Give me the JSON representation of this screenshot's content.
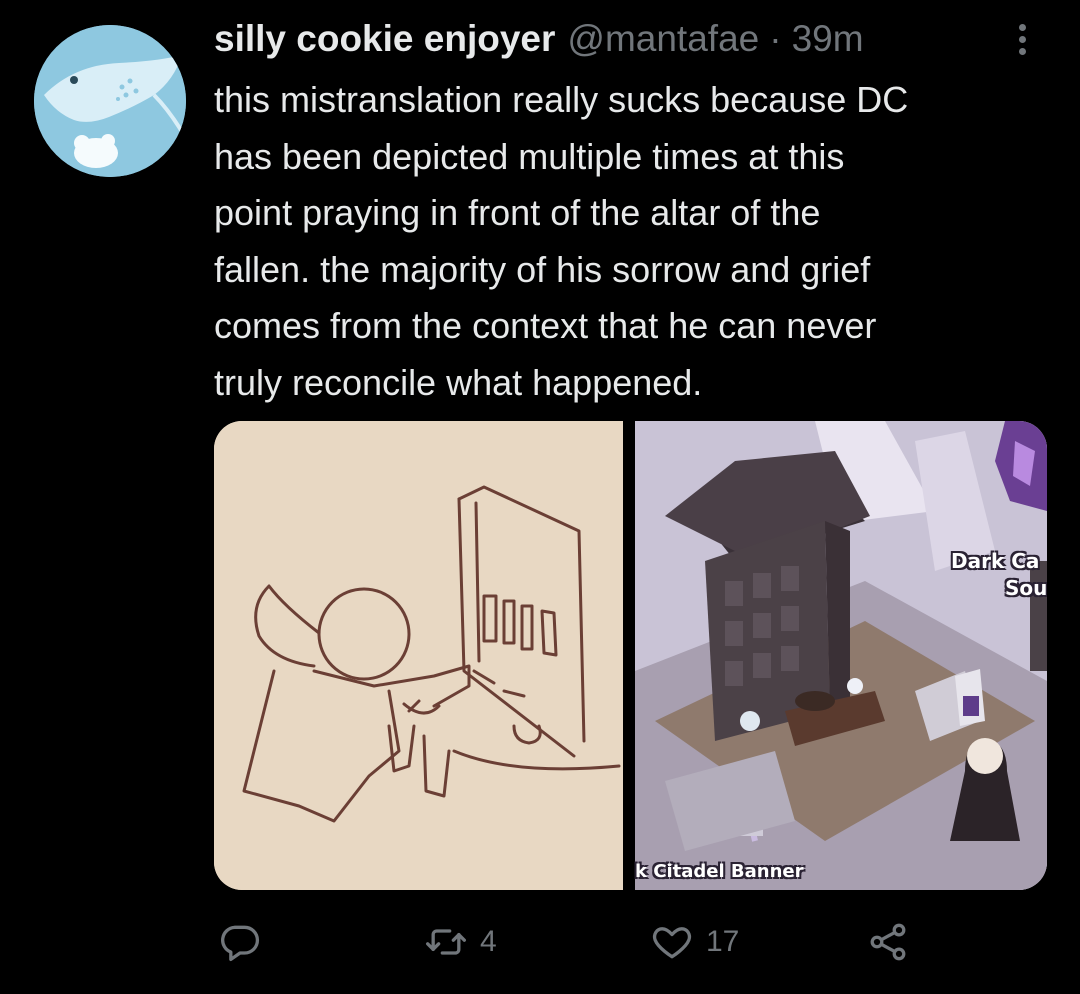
{
  "tweet": {
    "display_name": "silly cookie enjoyer",
    "handle": "@mantafae",
    "separator": "·",
    "time": "39m",
    "text": "this mistranslation really sucks because DC\nhas been depicted multiple times at this\npoint praying in front of the altar of the\nfallen. the majority of his sorrow and grief\ncomes from the context that he can never\ntruly reconcile what happened."
  },
  "media": {
    "right_image_labels": {
      "top_right_line1": "Dark Ca",
      "top_right_line2": "Sou",
      "bottom": "k Citadel Banner"
    }
  },
  "actions": {
    "reply_icon": "reply-icon",
    "retweet_icon": "retweet-icon",
    "retweet_count": "4",
    "like_icon": "heart-icon",
    "like_count": "17",
    "share_icon": "share-icon"
  },
  "colors": {
    "background": "#000000",
    "text_primary": "#e7e9ea",
    "text_secondary": "#71767b",
    "avatar_bg": "#8ec8e0"
  }
}
